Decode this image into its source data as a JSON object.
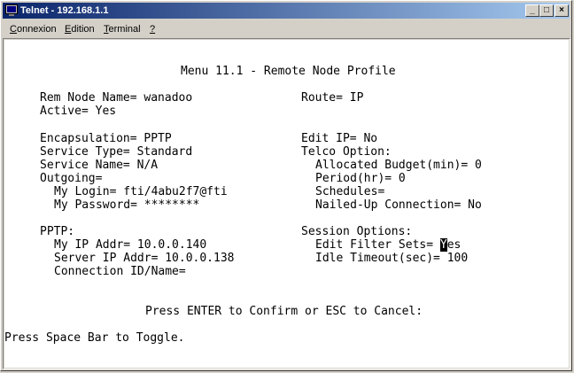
{
  "window": {
    "title": "Telnet - 192.168.1.1",
    "controls": {
      "minimize": "_",
      "maximize": "□",
      "close": "×"
    }
  },
  "menubar": {
    "connexion": {
      "mnemonic": "C",
      "rest": "onnexion"
    },
    "edition": {
      "mnemonic": "E",
      "rest": "dition"
    },
    "terminal": {
      "mnemonic": "T",
      "rest": "erminal"
    },
    "help": {
      "mnemonic": "?",
      "rest": ""
    }
  },
  "terminal": {
    "menu_title": "Menu 11.1 - Remote Node Profile",
    "rem_node_name": "Rem Node Name= wanadoo",
    "route": "Route= IP",
    "active": "Active= Yes",
    "encapsulation": "Encapsulation= PPTP",
    "edit_ip": "Edit IP= No",
    "service_type": "Service Type= Standard",
    "telco_option": "Telco Option:",
    "service_name": "Service Name= N/A",
    "allocated_budget": "Allocated Budget(min)= 0",
    "outgoing": "Outgoing=",
    "period": "Period(hr)= 0",
    "my_login": "My Login= fti/4abu2f7@fti",
    "schedules": "Schedules=",
    "my_password": "My Password= ********",
    "nailed_up": "Nailed-Up Connection= No",
    "pptp": "PPTP:",
    "session_options": "Session Options:",
    "my_ip_addr": "My IP Addr= 10.0.0.140",
    "edit_filter_sets_label": "Edit Filter Sets= ",
    "edit_filter_sets_cursor": "Y",
    "edit_filter_sets_rest": "es",
    "server_ip_addr": "Server IP Addr= 10.0.0.138",
    "idle_timeout": "Idle Timeout(sec)= 100",
    "connection_id": "Connection ID/Name=",
    "confirm_prompt": "Press ENTER to Confirm or ESC to Cancel:",
    "status_line": "Press Space Bar to Toggle."
  }
}
